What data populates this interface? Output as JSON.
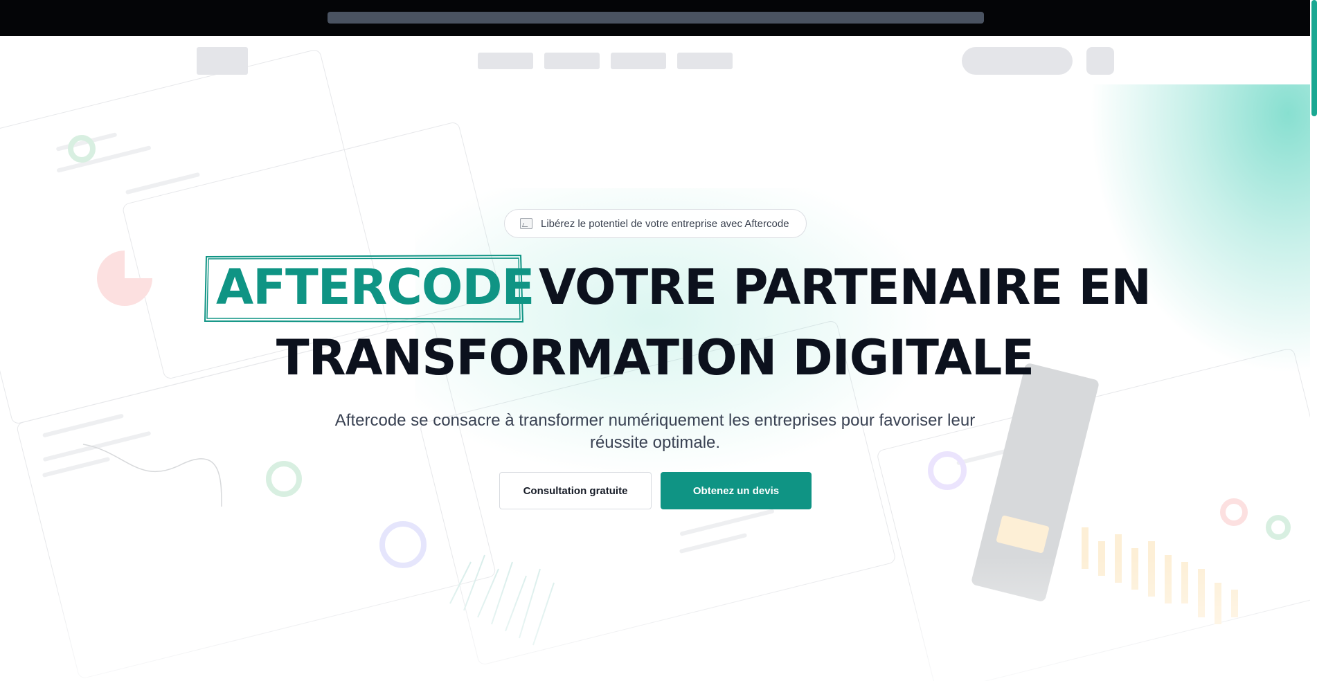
{
  "badge": {
    "text": "Libérez le potentiel de votre entreprise avec Aftercode",
    "icon": "broken-image-icon"
  },
  "hero": {
    "brand_word": "AFTERCODE",
    "headline_line1_rest": "VOTRE PARTENAIRE EN",
    "headline_line2": "TRANSFORMATION DIGITALE",
    "subtitle": "Aftercode se consacre à transformer numériquement les entreprises pour favoriser leur réussite optimale."
  },
  "buttons": {
    "consultation": "Consultation gratuite",
    "quote": "Obtenez un devis"
  },
  "colors": {
    "brand": "#0f9484",
    "heading": "#0c111d",
    "topbar": "#040507",
    "skeleton": "#e4e5e9"
  }
}
